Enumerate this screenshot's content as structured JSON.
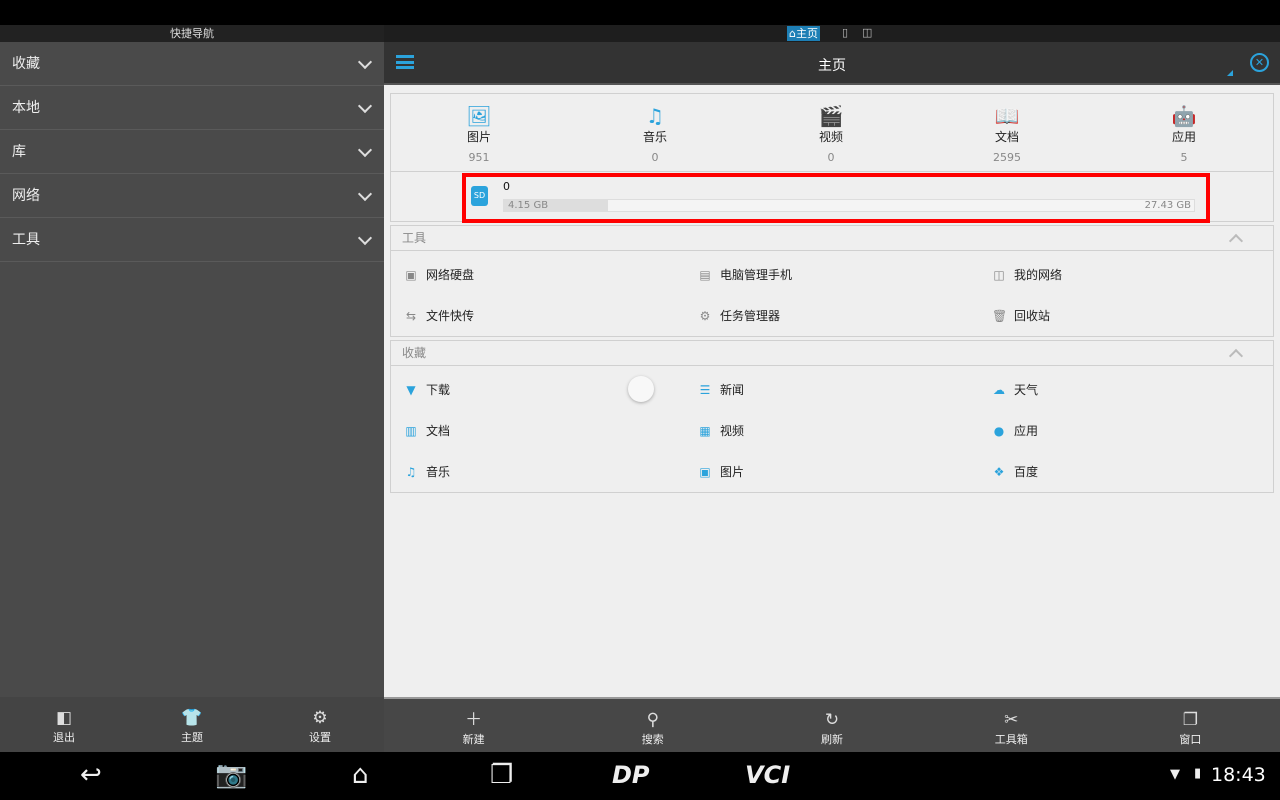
{
  "left_panel": {
    "title": "快捷导航",
    "items": [
      {
        "label": "收藏"
      },
      {
        "label": "本地"
      },
      {
        "label": "库"
      },
      {
        "label": "网络"
      },
      {
        "label": "工具"
      }
    ],
    "toolbar": [
      {
        "label": "退出",
        "icon": "exit-icon"
      },
      {
        "label": "主题",
        "icon": "shirt-icon"
      },
      {
        "label": "设置",
        "icon": "gear-icon"
      }
    ]
  },
  "tabs": {
    "active": "主页"
  },
  "header": {
    "title": "主页"
  },
  "categories": [
    {
      "label": "图片",
      "count": "951",
      "icon": "image-icon"
    },
    {
      "label": "音乐",
      "count": "0",
      "icon": "music-icon"
    },
    {
      "label": "视频",
      "count": "0",
      "icon": "video-icon"
    },
    {
      "label": "文档",
      "count": "2595",
      "icon": "book-icon"
    },
    {
      "label": "应用",
      "count": "5",
      "icon": "android-icon"
    }
  ],
  "storage": {
    "name": "0",
    "icon_label": "SD",
    "used": "4.15 GB",
    "total": "27.43 GB",
    "used_fraction": 0.151,
    "highlight_color": "#ff0000"
  },
  "tools": {
    "title": "工具",
    "items": [
      {
        "label": "网络硬盘"
      },
      {
        "label": "电脑管理手机"
      },
      {
        "label": "我的网络"
      },
      {
        "label": "文件快传"
      },
      {
        "label": "任务管理器"
      },
      {
        "label": "回收站"
      }
    ]
  },
  "favorites": {
    "title": "收藏",
    "items": [
      {
        "label": "下载"
      },
      {
        "label": "新闻"
      },
      {
        "label": "天气"
      },
      {
        "label": "文档"
      },
      {
        "label": "视频"
      },
      {
        "label": "应用"
      },
      {
        "label": "音乐"
      },
      {
        "label": "图片"
      },
      {
        "label": "百度"
      }
    ]
  },
  "toolbar": [
    {
      "label": "新建",
      "icon": "plus-icon"
    },
    {
      "label": "搜索",
      "icon": "search-icon"
    },
    {
      "label": "刷新",
      "icon": "refresh-icon"
    },
    {
      "label": "工具箱",
      "icon": "tools-icon"
    },
    {
      "label": "窗口",
      "icon": "window-icon"
    }
  ],
  "status": {
    "time": "18:43",
    "nav_logo_1": "DP",
    "nav_logo_2": "VCI"
  },
  "colors": {
    "accent": "#2ba3dc"
  }
}
